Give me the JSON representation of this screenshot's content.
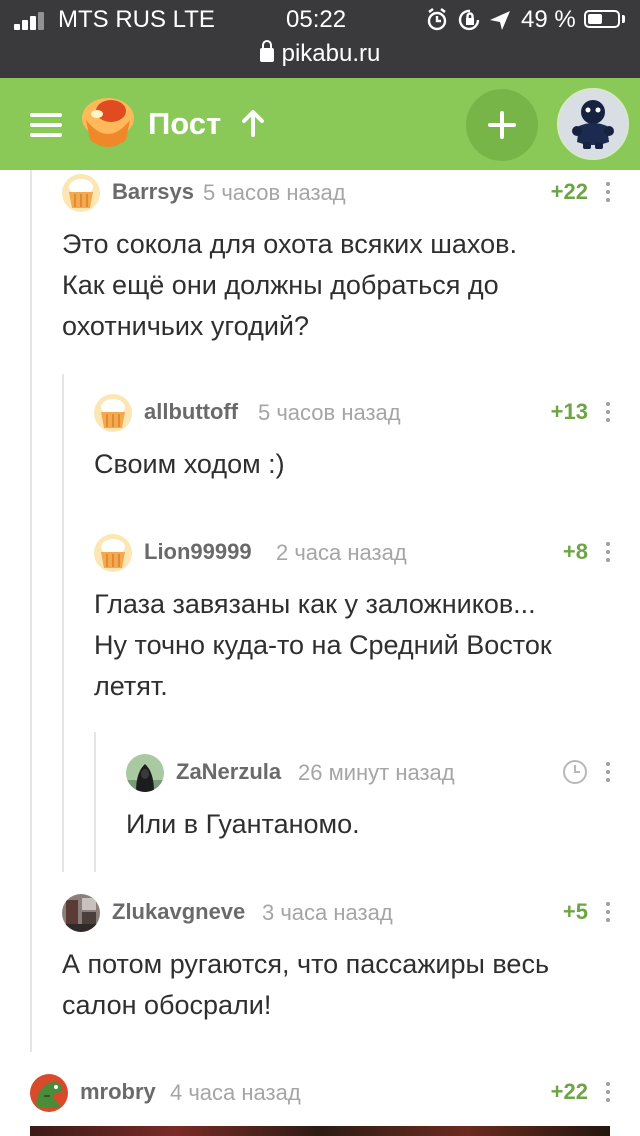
{
  "status_bar": {
    "carrier": "MTS RUS LTE",
    "time": "05:22",
    "battery": "49 %",
    "battery_level": 0.49,
    "url": "pikabu.ru",
    "icons": [
      "signal-icon",
      "alarm-icon",
      "rotation-lock-icon",
      "location-icon",
      "battery-icon",
      "lock-icon"
    ]
  },
  "navbar": {
    "title": "Пост",
    "icons": [
      "menu-icon",
      "pikabu-logo-icon",
      "arrow-up-icon",
      "plus-icon",
      "user-avatar"
    ],
    "colors": {
      "background": "#8ac858",
      "button": "#78b548"
    }
  },
  "comments": [
    {
      "user": "Barrsys",
      "time": "5 часов назад",
      "score": "+22",
      "avatar": "default-cupcake-avatar",
      "lines": [
        "Это сокола для охота всяких шахов.",
        "Как ещё они должны добраться до",
        "охотничьих угодий?"
      ]
    },
    {
      "user": "allbuttoff",
      "time": "5 часов назад",
      "score": "+13",
      "avatar": "default-cupcake-avatar",
      "lines": [
        "Своим ходом :)"
      ]
    },
    {
      "user": "Lion99999",
      "time": "2 часа назад",
      "score": "+8",
      "avatar": "default-cupcake-avatar",
      "lines": [
        "Глаза завязаны как у заложников...",
        "Ну точно куда-то на Средний Восток",
        "летят."
      ]
    },
    {
      "user": "ZaNerzula",
      "time": "26 минут назад",
      "score": "",
      "avatar": "hooded-figure-avatar",
      "pending_icon": "clock-icon",
      "lines": [
        "Или в Гуантаномо."
      ]
    },
    {
      "user": "Zlukavgneve",
      "time": "3 часа назад",
      "score": "+5",
      "avatar": "photo-avatar",
      "lines": [
        "А потом ругаются, что пассажиры весь",
        "салон обосрали!"
      ]
    },
    {
      "user": "mrobry",
      "time": "4 часа назад",
      "score": "+22",
      "avatar": "dinosaur-avatar",
      "lines": []
    }
  ],
  "colors": {
    "score": "#6da444",
    "username": "#6a6a6a",
    "time": "#a5a5a5",
    "text": "#2f2f2f"
  }
}
